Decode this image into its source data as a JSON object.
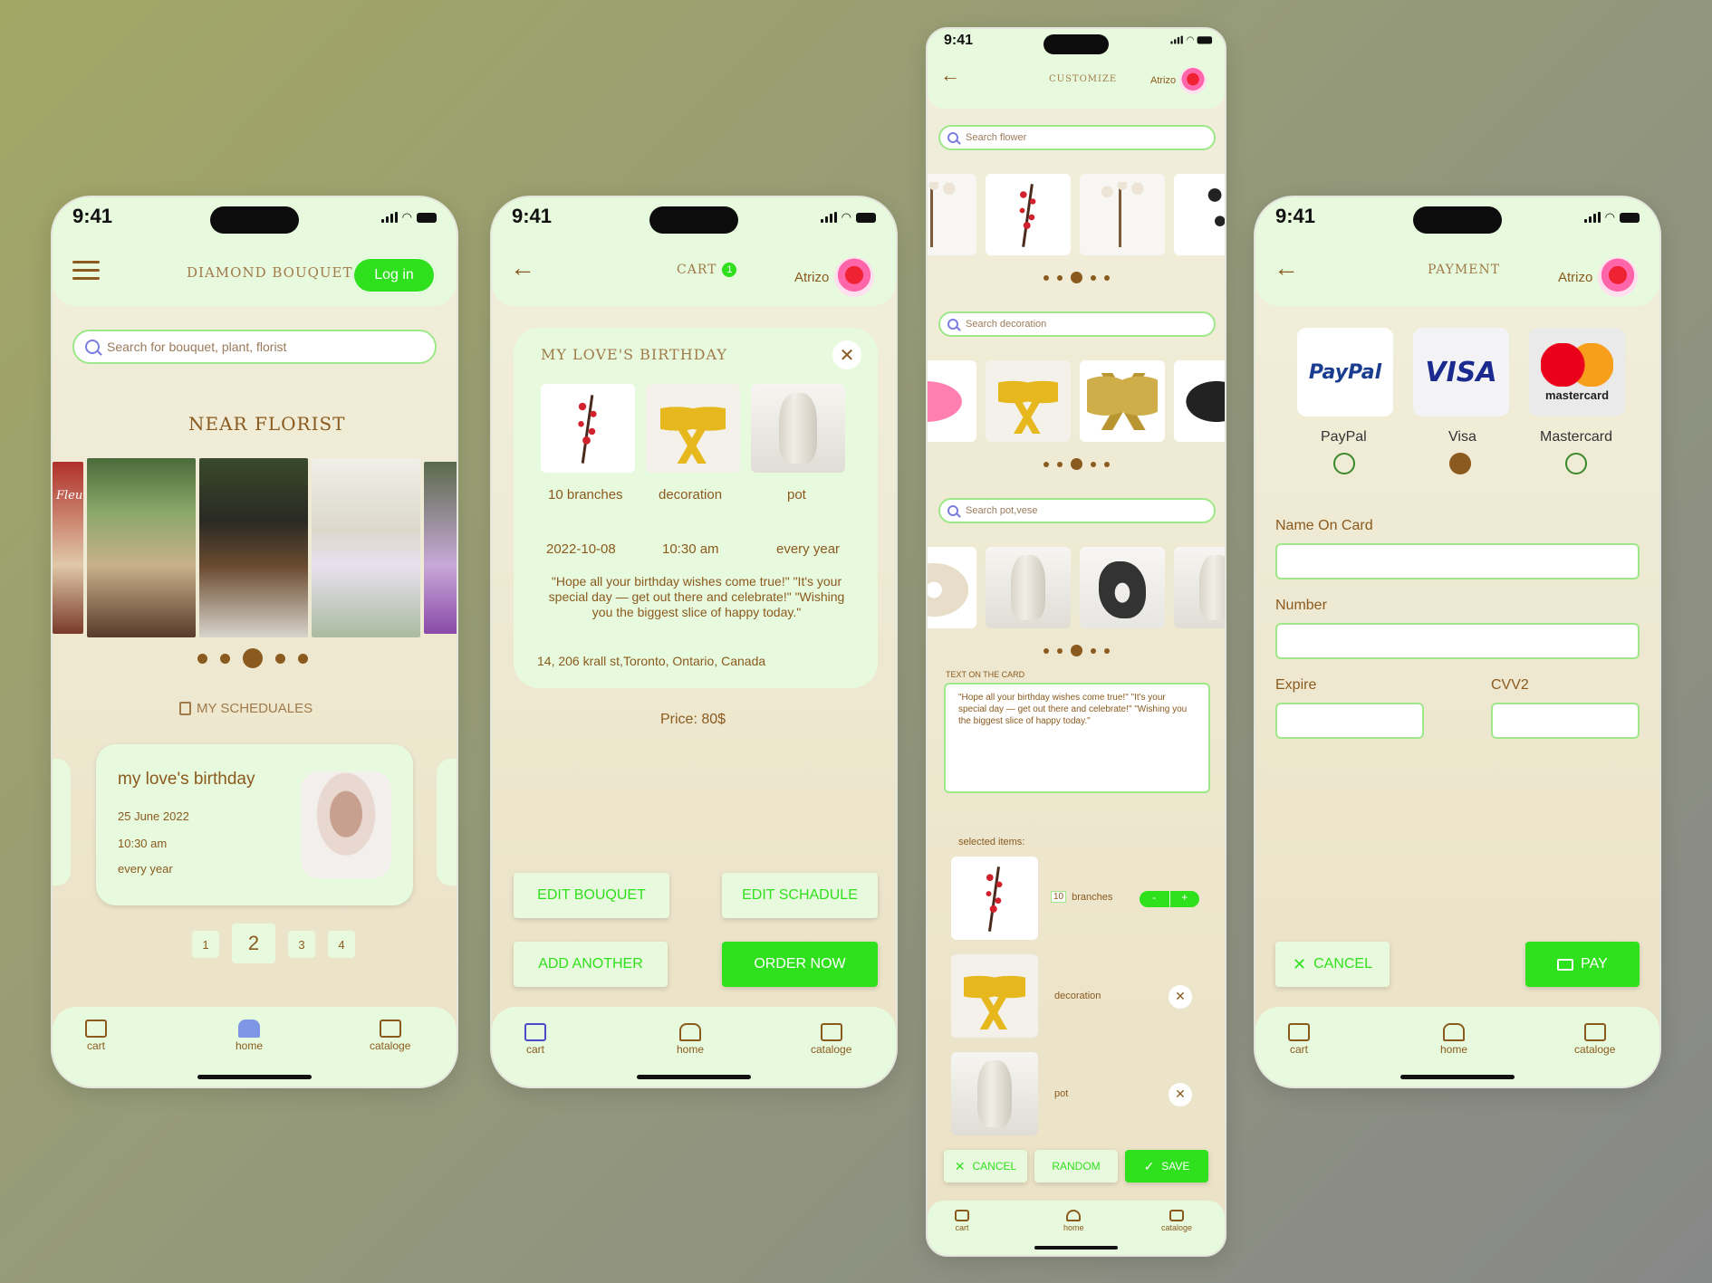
{
  "status": {
    "time": "9:41"
  },
  "screen1": {
    "brand": "DIAMOND BOUQUET",
    "login_label": "Log in",
    "search_placeholder": "Search for bouquet, plant, florist",
    "section_title": "NEAR FLORIST",
    "schedules_title": "MY SCHEDUALES",
    "schedule_card": {
      "title": "my love's birthday",
      "date": "25 June 2022",
      "time": "10:30 am",
      "repeat": "every year"
    },
    "pages": [
      "1",
      "2",
      "3",
      "4"
    ],
    "florist_sign": "Fleu"
  },
  "screen2": {
    "title": "CART",
    "cart_count": "1",
    "user": "Atrizo",
    "order": {
      "title": "MY LOVE'S BIRTHDAY",
      "items": [
        {
          "label": "10 branches",
          "icon": "red-branch"
        },
        {
          "label": "decoration",
          "icon": "yellow-bow"
        },
        {
          "label": "pot",
          "icon": "white-vase"
        }
      ],
      "date": "2022-10-08",
      "time": "10:30 am",
      "repeat": "every year",
      "message": "\"Hope all your birthday wishes come true!\" \"It's your special day — get out there and celebrate!\" \"Wishing you the biggest slice of happy today.\"",
      "address": "14, 206 krall st,Toronto, Ontario, Canada"
    },
    "price": "Price: 80$",
    "buttons": {
      "edit_bouquet": "EDIT BOUQUET",
      "edit_schedule": "EDIT SCHADULE",
      "add_another": "ADD ANOTHER",
      "order_now": "ORDER NOW"
    }
  },
  "screen3": {
    "title": "CUSTOMIZE",
    "user": "Atrizo",
    "search_flower": "Search flower",
    "search_decoration": "Search decoration",
    "search_pot": "Search pot,vese",
    "card_text_label": "TEXT ON THE CARD",
    "card_text": "\"Hope all your birthday wishes come true!\" \"It's your special day — get out there and celebrate!\" \"Wishing you the biggest slice of happy today.\"",
    "selected_label": "selected items:",
    "selected": [
      {
        "qty": "10",
        "label": "branches"
      },
      {
        "label": "decoration"
      },
      {
        "label": "pot"
      }
    ],
    "stepper": {
      "minus": "-",
      "plus": "+"
    },
    "buttons": {
      "cancel": "CANCEL",
      "random": "RANDOM",
      "save": "SAVE"
    }
  },
  "screen4": {
    "title": "PAYMENT",
    "user": "Atrizo",
    "methods": [
      {
        "label": "PayPal",
        "logo": "PayPal",
        "selected": false
      },
      {
        "label": "Visa",
        "logo": "VISA",
        "selected": true
      },
      {
        "label": "Mastercard",
        "logo": "mastercard",
        "selected": false
      }
    ],
    "fields": {
      "name": "Name On Card",
      "number": "Number",
      "expire": "Expire",
      "cvv": "CVV2"
    },
    "buttons": {
      "cancel": "CANCEL",
      "pay": "PAY"
    }
  },
  "nav": {
    "cart": "cart",
    "home": "home",
    "catalog": "cataloge"
  },
  "colors": {
    "accent_green": "#2fe01c",
    "brown": "#8a5a1e",
    "panel_green": "#e8fadd",
    "field_border": "#9ee88a"
  }
}
